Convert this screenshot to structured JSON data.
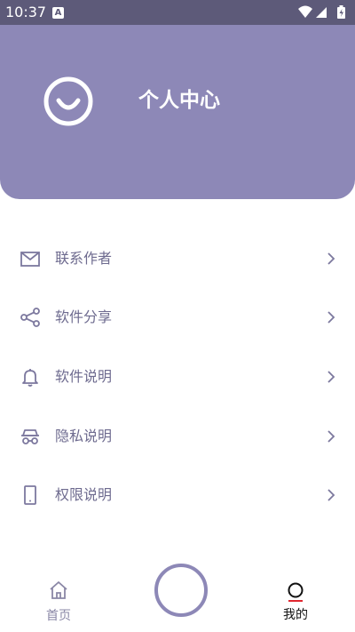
{
  "status_bar": {
    "time": "10:37",
    "app_badge": "A"
  },
  "header": {
    "title": "个人中心",
    "icon": "smiley-avatar-icon"
  },
  "menu": {
    "items": [
      {
        "label": "联系作者",
        "icon": "mail-icon"
      },
      {
        "label": "软件分享",
        "icon": "share-icon"
      },
      {
        "label": "软件说明",
        "icon": "bell-icon"
      },
      {
        "label": "隐私说明",
        "icon": "incognito-icon"
      },
      {
        "label": "权限说明",
        "icon": "phone-icon"
      }
    ]
  },
  "bottom_nav": {
    "home_label": "首页",
    "mine_label": "我的"
  },
  "colors": {
    "status_bar": "#5d5a79",
    "header": "#8d88b7",
    "menu_text": "#6e6b8f",
    "active_underline": "#e0262f"
  }
}
